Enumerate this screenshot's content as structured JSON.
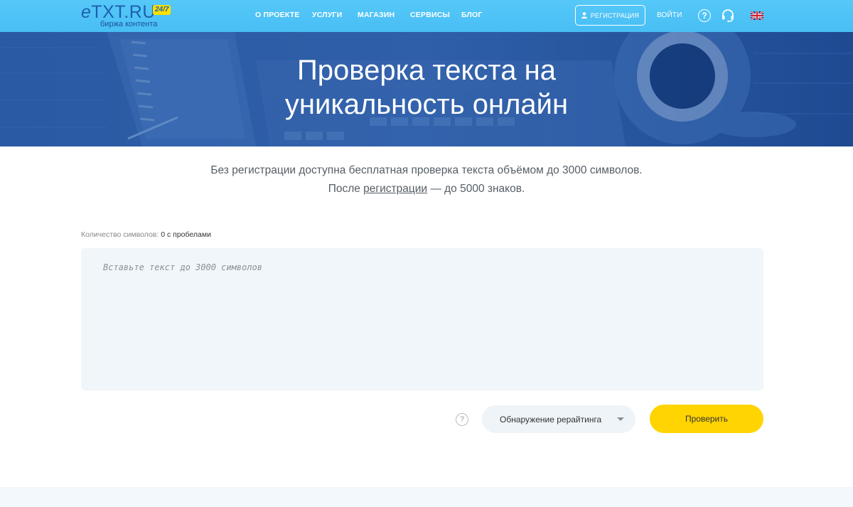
{
  "header": {
    "logo_text": "TXT.RU",
    "logo_badge": "24/7",
    "logo_sub": "биржа контента",
    "nav": [
      {
        "label": "О ПРОЕКТЕ"
      },
      {
        "label": "УСЛУГИ"
      },
      {
        "label": "МАГАЗИН"
      },
      {
        "label": "СЕРВИСЫ"
      },
      {
        "label": "БЛОГ"
      }
    ],
    "register_label": "РЕГИСТРАЦИЯ",
    "login_label": "ВОЙТИ",
    "help_glyph": "?",
    "icons": {
      "register": "user-icon",
      "help": "question-circle-icon",
      "support": "headset-icon",
      "language": "uk-flag-icon"
    }
  },
  "hero": {
    "title_line1": "Проверка текста на",
    "title_line2": "уникальность онлайн"
  },
  "intro": {
    "line1": "Без регистрации доступна бесплатная проверка текста объёмом до 3000 символов.",
    "line2_before": "После ",
    "line2_link": "регистрации",
    "line2_after": " — до 5000 знаков."
  },
  "checker": {
    "counter_label": "Количество символов: ",
    "counter_value": "0 с пробелами",
    "textarea_value": "",
    "textarea_placeholder": "Вставьте текст до 3000 символов",
    "help_glyph": "?",
    "mode_selected": "Обнаружение рерайтинга",
    "submit_label": "Проверить"
  },
  "colors": {
    "header_bg": "#4fc3f7",
    "hero_bg": "#1f4f98",
    "button_yellow": "#ffd400",
    "textarea_bg": "#f0f6fa"
  }
}
